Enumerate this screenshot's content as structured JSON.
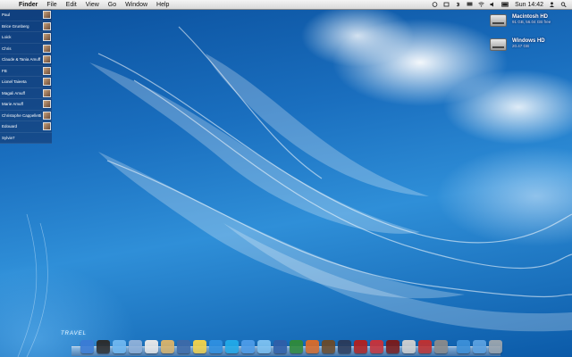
{
  "menubar": {
    "apple_glyph": "",
    "app": "Finder",
    "menus": [
      "File",
      "Edit",
      "View",
      "Go",
      "Window",
      "Help"
    ],
    "clock": "Sun 14:42"
  },
  "userlist": [
    {
      "label": "Paul",
      "thumb": true
    },
    {
      "label": "Brice Grunberg",
      "thumb": true
    },
    {
      "label": "Loick",
      "thumb": true
    },
    {
      "label": "Chris",
      "thumb": true
    },
    {
      "label": "Claude & Tania Amuff",
      "thumb": true
    },
    {
      "label": "FB",
      "thumb": true
    },
    {
      "label": "Lionel Taieeta",
      "thumb": true
    },
    {
      "label": "Magali Amuff",
      "thumb": true
    },
    {
      "label": "Marie Amuff",
      "thumb": true
    },
    {
      "label": "Christophe Cappelletti",
      "thumb": true
    },
    {
      "label": "Edouard",
      "thumb": true
    },
    {
      "label": "Sylvie7",
      "thumb": false
    }
  ],
  "drives": [
    {
      "name": "Macintosh HD",
      "sub": "91 GB, 56.04 GB free"
    },
    {
      "name": "Windows HD",
      "sub": "20.47 GB"
    }
  ],
  "dock_label": "TRAVEL",
  "dock": {
    "apps": [
      {
        "icon": "finder-icon",
        "color": "#3a7bd5"
      },
      {
        "icon": "dashboard-icon",
        "color": "#2b2b2b"
      },
      {
        "icon": "safari-icon",
        "color": "#6fb7f0"
      },
      {
        "icon": "mail-icon",
        "color": "#8fb0d8"
      },
      {
        "icon": "calendar-icon",
        "color": "#e8e8e8"
      },
      {
        "icon": "notes-icon",
        "color": "#d9b36a"
      },
      {
        "icon": "iphoto-icon",
        "color": "#3d6aa8"
      },
      {
        "icon": "preview-icon",
        "color": "#f2d24a"
      },
      {
        "icon": "itunes-icon",
        "color": "#2e8fe0"
      },
      {
        "icon": "skype-icon",
        "color": "#21a9e8"
      },
      {
        "icon": "ichat-icon",
        "color": "#4c9be8"
      },
      {
        "icon": "messages-icon",
        "color": "#7cc0f0"
      },
      {
        "icon": "word-icon",
        "color": "#2f5ea8"
      },
      {
        "icon": "excel-icon",
        "color": "#2f8a3a"
      },
      {
        "icon": "powerpoint-icon",
        "color": "#d86b2a"
      },
      {
        "icon": "imovie-icon",
        "color": "#6a4a2a"
      },
      {
        "icon": "photoshop-icon",
        "color": "#2a3a5a"
      },
      {
        "icon": "flash-icon",
        "color": "#b02020"
      },
      {
        "icon": "chair-icon",
        "color": "#c8323a"
      },
      {
        "icon": "book-icon",
        "color": "#7a1a1a"
      },
      {
        "icon": "tools-icon",
        "color": "#cfcfcf"
      },
      {
        "icon": "stamp-icon",
        "color": "#c03030"
      },
      {
        "icon": "system-preferences-icon",
        "color": "#8a8a8a"
      }
    ],
    "stacks": [
      {
        "icon": "downloads-icon",
        "color": "#3b8fd8"
      },
      {
        "icon": "documents-icon",
        "color": "#5aa0e0"
      },
      {
        "icon": "trash-icon",
        "color": "#9aa4ad"
      }
    ]
  }
}
